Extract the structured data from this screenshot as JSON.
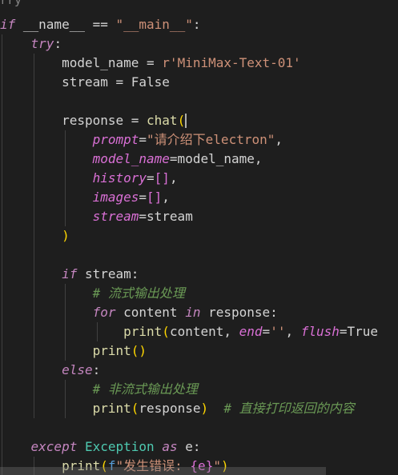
{
  "editor": {
    "top_fragment": "rry                                      ",
    "lines": [
      [
        {
          "t": "if",
          "c": "kwc"
        },
        {
          "t": " __name__ == "
        },
        {
          "t": "\"__main__\"",
          "c": "str"
        },
        {
          "t": ":"
        }
      ],
      [
        {
          "t": "    "
        },
        {
          "t": "try",
          "c": "kwc"
        },
        {
          "t": ":"
        }
      ],
      [
        {
          "t": "        model_name = "
        },
        {
          "t": "r'MiniMax-Text-01'",
          "c": "str"
        }
      ],
      [
        {
          "t": "        stream = False"
        }
      ],
      [],
      [
        {
          "t": "        response = "
        },
        {
          "t": "chat",
          "c": "fn"
        },
        {
          "t": "(",
          "c": "b1"
        }
      ],
      [
        {
          "t": "            "
        },
        {
          "t": "prompt",
          "c": "par"
        },
        {
          "t": "="
        },
        {
          "t": "\"请介绍下electron\"",
          "c": "str"
        },
        {
          "t": ","
        }
      ],
      [
        {
          "t": "            "
        },
        {
          "t": "model_name",
          "c": "par"
        },
        {
          "t": "=model_name,"
        }
      ],
      [
        {
          "t": "            "
        },
        {
          "t": "history",
          "c": "par"
        },
        {
          "t": "="
        },
        {
          "t": "[]",
          "c": "b2"
        },
        {
          "t": ","
        }
      ],
      [
        {
          "t": "            "
        },
        {
          "t": "images",
          "c": "par"
        },
        {
          "t": "="
        },
        {
          "t": "[]",
          "c": "b2"
        },
        {
          "t": ","
        }
      ],
      [
        {
          "t": "            "
        },
        {
          "t": "stream",
          "c": "par"
        },
        {
          "t": "=stream"
        }
      ],
      [
        {
          "t": "        "
        },
        {
          "t": ")",
          "c": "b1"
        }
      ],
      [],
      [
        {
          "t": "        "
        },
        {
          "t": "if",
          "c": "kwc"
        },
        {
          "t": " stream:"
        }
      ],
      [
        {
          "t": "            "
        },
        {
          "t": "# 流式输出处理",
          "c": "cmt"
        }
      ],
      [
        {
          "t": "            "
        },
        {
          "t": "for",
          "c": "kwc"
        },
        {
          "t": " content "
        },
        {
          "t": "in",
          "c": "kwc"
        },
        {
          "t": " response:"
        }
      ],
      [
        {
          "t": "                "
        },
        {
          "t": "print",
          "c": "fn"
        },
        {
          "t": "(",
          "c": "b1"
        },
        {
          "t": "content, "
        },
        {
          "t": "end",
          "c": "par"
        },
        {
          "t": "="
        },
        {
          "t": "''",
          "c": "str"
        },
        {
          "t": ", "
        },
        {
          "t": "flush",
          "c": "par"
        },
        {
          "t": "=True"
        }
      ],
      [
        {
          "t": "            "
        },
        {
          "t": "print",
          "c": "fn"
        },
        {
          "t": "()",
          "c": "b1"
        }
      ],
      [
        {
          "t": "        "
        },
        {
          "t": "else",
          "c": "kwc"
        },
        {
          "t": ":"
        }
      ],
      [
        {
          "t": "            "
        },
        {
          "t": "# 非流式输出处理",
          "c": "cmt"
        }
      ],
      [
        {
          "t": "            "
        },
        {
          "t": "print",
          "c": "fn"
        },
        {
          "t": "(",
          "c": "b1"
        },
        {
          "t": "response"
        },
        {
          "t": ")",
          "c": "b1"
        },
        {
          "t": "  "
        },
        {
          "t": "# 直接打印返回的内容",
          "c": "cmt"
        }
      ],
      [],
      [
        {
          "t": "    "
        },
        {
          "t": "except",
          "c": "kwc"
        },
        {
          "t": " "
        },
        {
          "t": "Exception",
          "c": "cls"
        },
        {
          "t": " "
        },
        {
          "t": "as",
          "c": "kwc"
        },
        {
          "t": " e:"
        }
      ],
      [
        {
          "t": "        "
        },
        {
          "t": "print",
          "c": "fn"
        },
        {
          "t": "(",
          "c": "b1"
        },
        {
          "t": "f",
          "c": "fpre"
        },
        {
          "t": "\"发生错误: ",
          "c": "str"
        },
        {
          "t": "{e}",
          "c": "b2"
        },
        {
          "t": "\"",
          "c": "str"
        },
        {
          "t": ")",
          "c": "b1"
        }
      ]
    ]
  }
}
